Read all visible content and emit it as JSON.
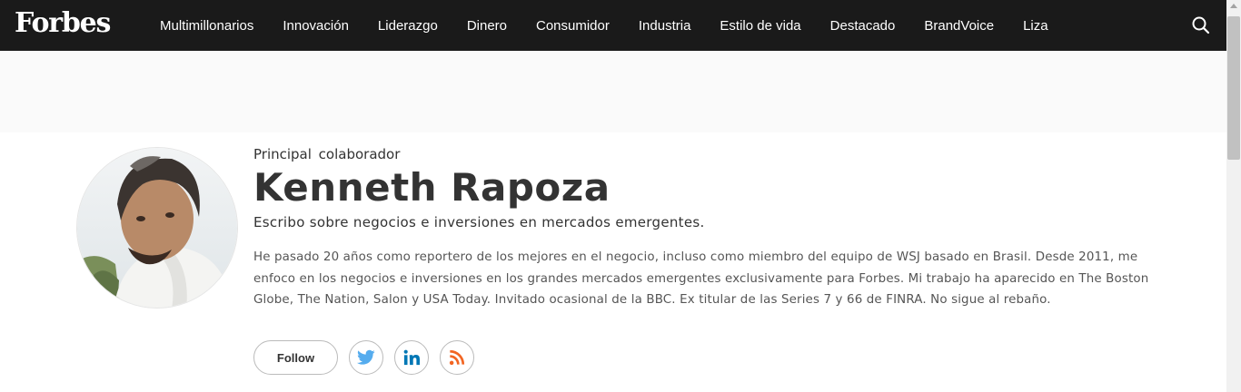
{
  "brand": {
    "logo": "Forbes"
  },
  "nav": {
    "items": [
      "Multimillonarios",
      "Innovación",
      "Liderazgo",
      "Dinero",
      "Consumidor",
      "Industria",
      "Estilo de vida",
      "Destacado",
      "BrandVoice",
      "Liza"
    ],
    "search_icon": "search-icon"
  },
  "profile": {
    "role": "Principal  colaborador",
    "name": "Kenneth Rapoza",
    "tagline": "Escribo sobre negocios e inversiones en mercados emergentes.",
    "bio": "He pasado 20 años como reportero de los mejores en el negocio, incluso como miembro del equipo de WSJ basado en Brasil. Desde 2011, me enfoco en los negocios e inversiones en los grandes mercados emergentes exclusivamente para Forbes. Mi trabajo ha aparecido en The Boston Globe, The Nation, Salon y USA Today. Invitado ocasional de la BBC. Ex titular de las Series 7 y 66 de FINRA. No sigue al rebaño.",
    "follow_label": "Follow",
    "social": [
      {
        "name": "twitter-icon",
        "color": "#55acee"
      },
      {
        "name": "linkedin-icon",
        "color": "#0077b5"
      },
      {
        "name": "rss-icon",
        "color": "#f26522"
      }
    ]
  },
  "colors": {
    "nav_bg": "#1a1a1a",
    "banner_bg": "#fafafa",
    "text": "#333333"
  }
}
